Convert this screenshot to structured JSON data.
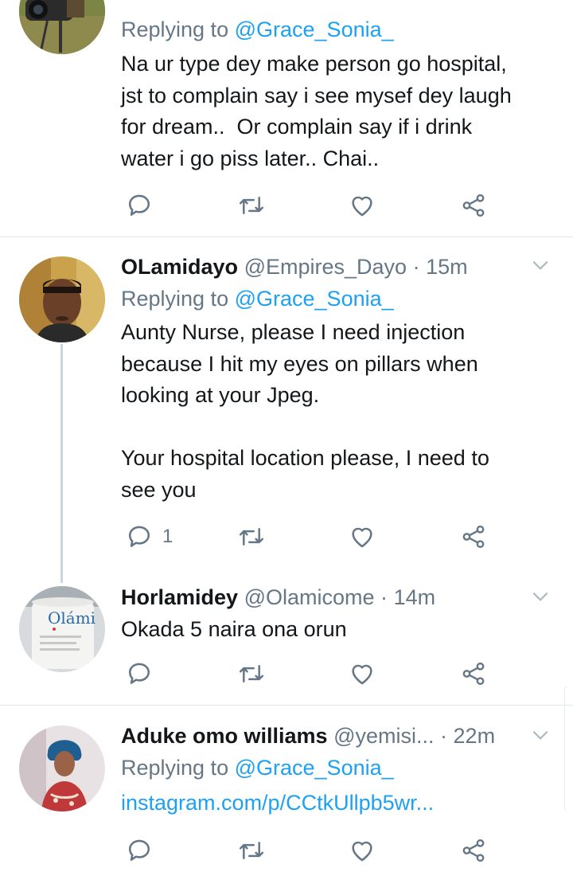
{
  "colors": {
    "link": "#1da1f2",
    "secondary": "#657786",
    "text": "#14171a",
    "divider": "#e1e8ed"
  },
  "tweets": [
    {
      "reply_prefix": "Replying to",
      "reply_to": "@Grace_Sonia_",
      "text": "Na ur type dey make person go hospital,\njst to complain say i see mysef dey laugh\nfor dream..  Or complain say if i drink\nwater i go piss later.. Chai..",
      "reply_count": ""
    },
    {
      "name": "OLamidayo",
      "handle": "@Empires_Dayo",
      "dot": "·",
      "time": "15m",
      "reply_prefix": "Replying to",
      "reply_to": "@Grace_Sonia_",
      "text": "Aunty Nurse, please I need injection\nbecause I hit my eyes on pillars when\nlooking at your Jpeg.\n\nYour hospital location please, I need to\nsee you",
      "reply_count": "1"
    },
    {
      "name": "Horlamidey",
      "handle": "@Olamicome",
      "dot": "·",
      "time": "14m",
      "text": "Okada 5 naira ona orun",
      "mug_text": "Olámi",
      "reply_count": ""
    },
    {
      "name": "Aduke omo williams",
      "handle": "@yemisi...",
      "dot": "·",
      "time": "22m",
      "reply_prefix": "Replying to",
      "reply_to": "@Grace_Sonia_",
      "link": "instagram.com/p/CCtkUllpb5wr...",
      "reply_count": ""
    }
  ]
}
